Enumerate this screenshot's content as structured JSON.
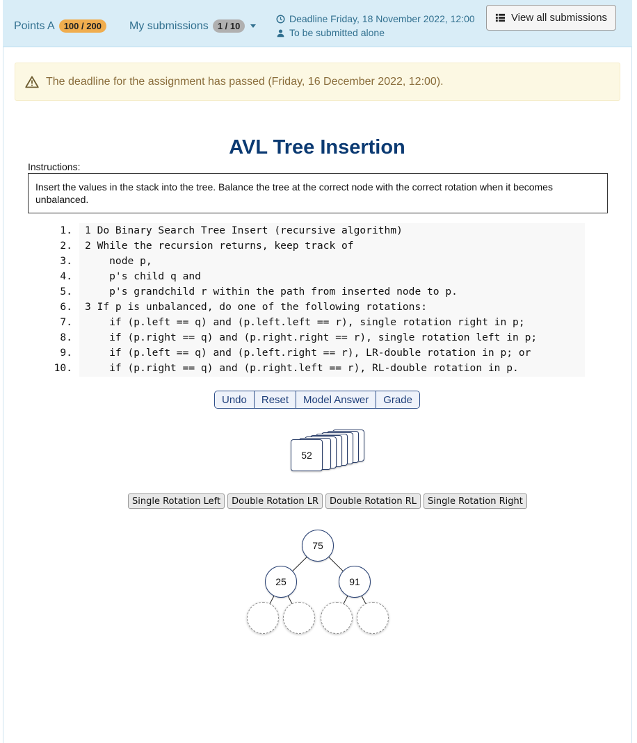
{
  "header": {
    "points_label": "Points A",
    "points_value": "100 / 200",
    "submissions_label": "My submissions",
    "submissions_value": "1 / 10",
    "deadline": "Deadline Friday, 18 November 2022, 12:00",
    "submit_mode": "To be submitted alone",
    "view_all_label": "View all submissions"
  },
  "alert": {
    "text": "The deadline for the assignment has passed (Friday, 16 December 2022, 12:00)."
  },
  "exercise": {
    "title": "AVL Tree Insertion",
    "instructions_label": "Instructions:",
    "instructions_text": "Insert the values in the stack into the tree. Balance the tree at the correct node with the correct rotation when it becomes unbalanced."
  },
  "code": [
    {
      "num": "1.",
      "text": "1 Do Binary Search Tree Insert (recursive algorithm)"
    },
    {
      "num": "2.",
      "text": "2 While the recursion returns, keep track of"
    },
    {
      "num": "3.",
      "text": "    node p,"
    },
    {
      "num": "4.",
      "text": "    p's child q and"
    },
    {
      "num": "5.",
      "text": "    p's grandchild r within the path from inserted node to p."
    },
    {
      "num": "6.",
      "text": "3 If p is unbalanced, do one of the following rotations:"
    },
    {
      "num": "7.",
      "text": "    if (p.left == q) and (p.left.left == r), single rotation right in p;"
    },
    {
      "num": "8.",
      "text": "    if (p.right == q) and (p.right.right == r), single rotation left in p;"
    },
    {
      "num": "9.",
      "text": "    if (p.left == q) and (p.left.right == r), LR-double rotation in p; or"
    },
    {
      "num": "10.",
      "text": "    if (p.right == q) and (p.right.left == r), RL-double rotation in p."
    }
  ],
  "controls": {
    "undo": "Undo",
    "reset": "Reset",
    "model_answer": "Model Answer",
    "grade": "Grade"
  },
  "stack": {
    "top_value": "52"
  },
  "rotations": {
    "single_left": "Single Rotation Left",
    "double_lr": "Double Rotation LR",
    "double_rl": "Double Rotation RL",
    "single_right": "Single Rotation Right"
  },
  "tree": {
    "root": "75",
    "left": "25",
    "right": "91"
  }
}
